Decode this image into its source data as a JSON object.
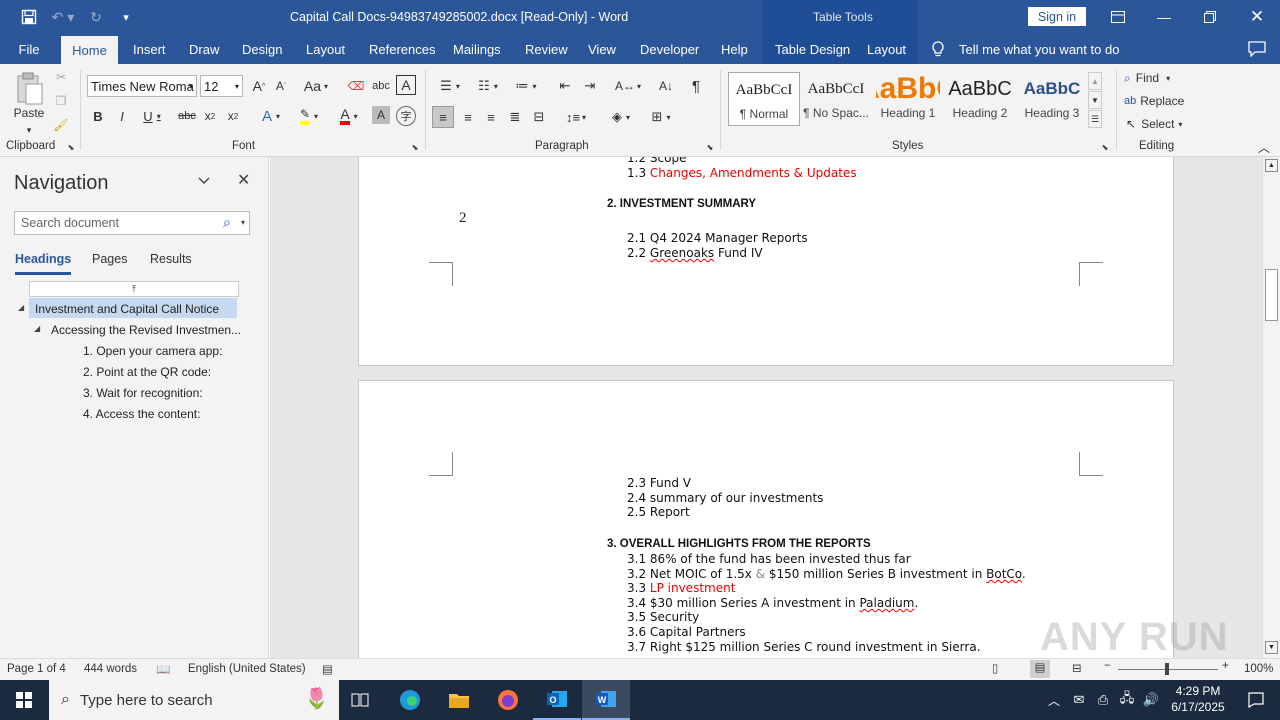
{
  "window": {
    "title": "Capital Call Docs-94983749285002.docx [Read-Only]  -  Word",
    "context_tab_group": "Table Tools",
    "sign_in": "Sign in"
  },
  "tabs": [
    "File",
    "Home",
    "Insert",
    "Draw",
    "Design",
    "Layout",
    "References",
    "Mailings",
    "Review",
    "View",
    "Developer",
    "Help",
    "Table Design",
    "Layout"
  ],
  "tell_me": "Tell me what you want to do",
  "ribbon": {
    "clipboard": {
      "paste": "Paste",
      "label": "Clipboard"
    },
    "font": {
      "name": "Times New Roma",
      "size": "12",
      "label": "Font",
      "case": "Aa"
    },
    "paragraph": {
      "label": "Paragraph"
    },
    "styles": {
      "label": "Styles",
      "items": [
        {
          "preview": "AaBbCcI",
          "name": "¶ Normal"
        },
        {
          "preview": "AaBbCcI",
          "name": "¶ No Spac..."
        },
        {
          "preview": "AaBbC",
          "name": "Heading 1"
        },
        {
          "preview": "AaBbC",
          "name": "Heading 2"
        },
        {
          "preview": "AaBbC",
          "name": "Heading 3"
        }
      ]
    },
    "editing": {
      "find": "Find",
      "replace": "Replace",
      "select": "Select",
      "label": "Editing"
    }
  },
  "navigation": {
    "title": "Navigation",
    "search_placeholder": "Search document",
    "tabs": [
      "Headings",
      "Pages",
      "Results"
    ],
    "headings": [
      "Investment and Capital Call Notice",
      "Accessing the Revised Investmen...",
      "1. Open your camera app:",
      "2. Point at the QR code:",
      "3. Wait for recognition:",
      "4. Access the content:"
    ]
  },
  "document": {
    "page_number": "2",
    "page1_lines": {
      "l1": "1.2 Scope",
      "l2_num": "1.3 ",
      "l2_text": "Changes, Amendments & Updates",
      "h2": "2. INVESTMENT SUMMARY",
      "l3": "2.1 Q4 2024 Manager Reports",
      "l4_num": "2.2 ",
      "l4_word": "Greenoaks",
      "l4_rest": " Fund IV"
    },
    "page2_lines": {
      "l1": "2.3 Fund V",
      "l2": "2.4 summary of our investments",
      "l3": "2.5 Report",
      "h3": "3. OVERALL HIGHLIGHTS FROM THE REPORTS",
      "l4": "3.1 86% of the fund has been invested thus far",
      "l5_a": "3.2 Net MOIC of 1.5x ",
      "l5_b": "&",
      "l5_c": " $150 million Series B investment in ",
      "l5_d": "BotCo",
      "l5_e": ".",
      "l6_num": "3.3 ",
      "l6_text": "LP investment",
      "l7_a": "3.4 $30 million Series A investment in ",
      "l7_b": "Paladium",
      "l7_c": ".",
      "l8": "3.5 Security",
      "l9": "3.6 Capital Partners",
      "l10": "3.7 Right $125 million Series C round investment in Sierra."
    }
  },
  "status": {
    "page": "Page 1 of 4",
    "words": "444 words",
    "language": "English (United States)",
    "zoom": "100%"
  },
  "taskbar": {
    "search_placeholder": "Type here to search",
    "time": "4:29 PM",
    "date": "6/17/2025"
  },
  "watermark": "ANY RUN",
  "colors": {
    "word_blue": "#2b579a",
    "red_text": "#e00000",
    "taskbar": "#1c2a3f"
  }
}
